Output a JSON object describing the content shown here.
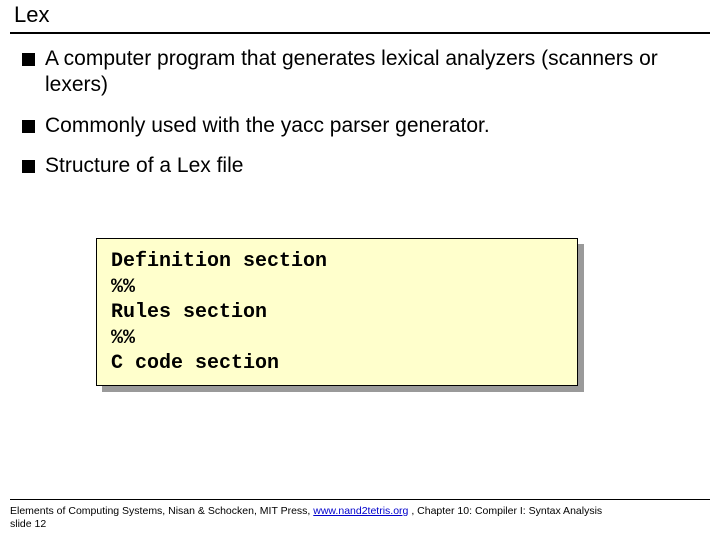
{
  "title": "Lex",
  "bullets": [
    "A computer program that generates lexical analyzers (scanners or lexers)",
    "Commonly used with the yacc parser generator.",
    "Structure of a Lex file"
  ],
  "code": "Definition section\n%%\nRules section\n%%\nC code section",
  "footer": {
    "pre": "Elements of Computing Systems, Nisan & Schocken, MIT Press, ",
    "link": "www.nand2tetris.org",
    "post": " , Chapter 10: Compiler I: Syntax Analysis",
    "slide": "slide 12"
  }
}
